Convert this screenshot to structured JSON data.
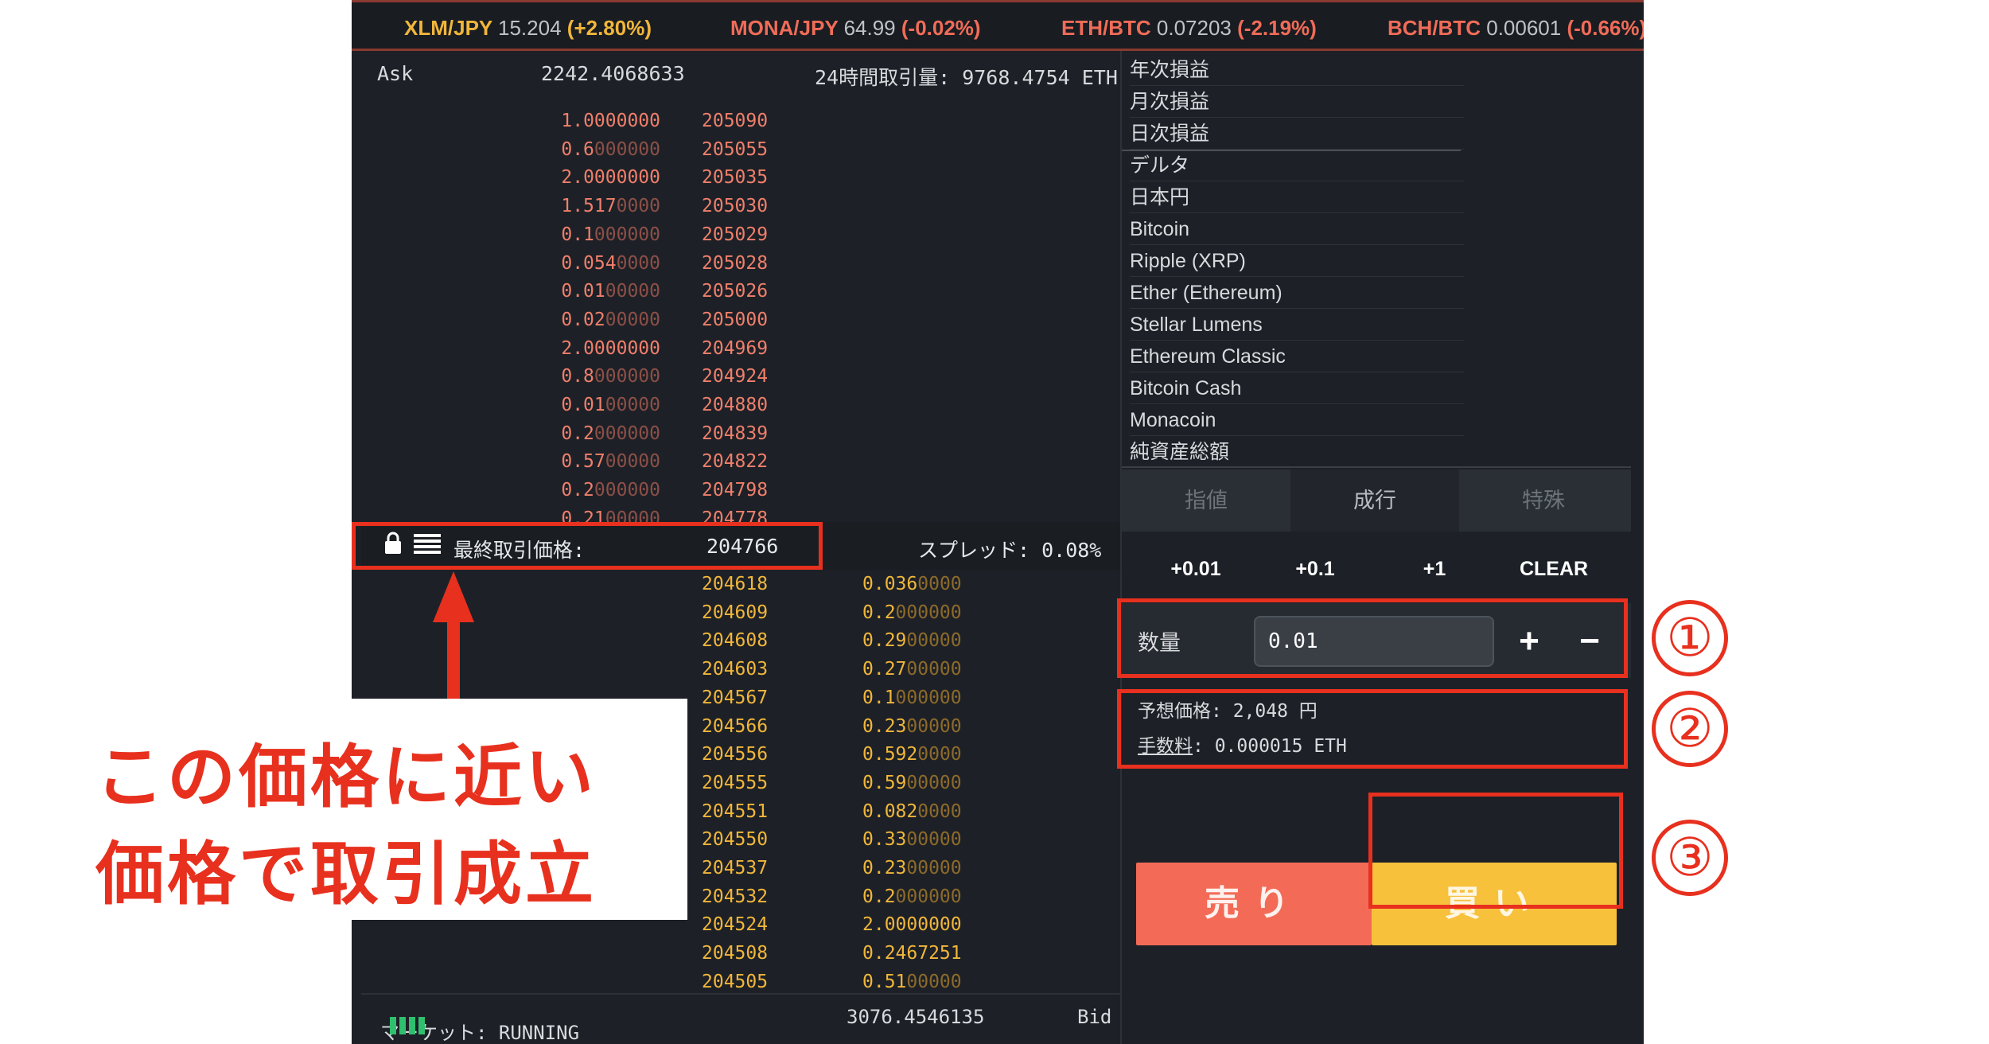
{
  "ticker": [
    {
      "symbol": "XLM/JPY",
      "price": "15.204",
      "change": "(+2.80%)",
      "dir": "up"
    },
    {
      "symbol": "MONA/JPY",
      "price": "64.99",
      "change": "(-0.02%)",
      "dir": "down"
    },
    {
      "symbol": "ETH/BTC",
      "price": "0.07203",
      "change": "(-2.19%)",
      "dir": "down"
    },
    {
      "symbol": "BCH/BTC",
      "price": "0.00601",
      "change": "(-0.66%)",
      "dir": "down"
    }
  ],
  "book": {
    "ask_label": "Ask",
    "ask_total": "2242.4068633",
    "volume_24h": "24時間取引量: 9768.4754 ETH",
    "asks": [
      {
        "qty": "1.0000000",
        "price": "205090"
      },
      {
        "qty": "0.6000000",
        "price": "205055"
      },
      {
        "qty": "2.0000000",
        "price": "205035"
      },
      {
        "qty": "1.5170000",
        "price": "205030"
      },
      {
        "qty": "0.1000000",
        "price": "205029"
      },
      {
        "qty": "0.0540000",
        "price": "205028"
      },
      {
        "qty": "0.0100000",
        "price": "205026"
      },
      {
        "qty": "0.0200000",
        "price": "205000"
      },
      {
        "qty": "2.0000000",
        "price": "204969"
      },
      {
        "qty": "0.8000000",
        "price": "204924"
      },
      {
        "qty": "0.0100000",
        "price": "204880"
      },
      {
        "qty": "0.2000000",
        "price": "204839"
      },
      {
        "qty": "0.5700000",
        "price": "204822"
      },
      {
        "qty": "0.2000000",
        "price": "204798"
      },
      {
        "qty": "0.2100000",
        "price": "204778"
      }
    ],
    "last_label": "最終取引価格:",
    "last_price": "204766",
    "spread": "スプレッド: 0.08%",
    "bids": [
      {
        "price": "204618",
        "qty": "0.0360000"
      },
      {
        "price": "204609",
        "qty": "0.2000000"
      },
      {
        "price": "204608",
        "qty": "0.2900000"
      },
      {
        "price": "204603",
        "qty": "0.2700000"
      },
      {
        "price": "204567",
        "qty": "0.1000000"
      },
      {
        "price": "204566",
        "qty": "0.2300000"
      },
      {
        "price": "204556",
        "qty": "0.5920000"
      },
      {
        "price": "204555",
        "qty": "0.5900000"
      },
      {
        "price": "204551",
        "qty": "0.0820000"
      },
      {
        "price": "204550",
        "qty": "0.3300000"
      },
      {
        "price": "204537",
        "qty": "0.2300000"
      },
      {
        "price": "204532",
        "qty": "0.2000000"
      },
      {
        "price": "204524",
        "qty": "2.0000000"
      },
      {
        "price": "204508",
        "qty": "0.2467251"
      },
      {
        "price": "204505",
        "qty": "0.5100000"
      }
    ],
    "market_status": "マーケット: RUNNING",
    "bid_total": "3076.4546135",
    "bid_label": "Bid"
  },
  "summary": [
    "年次損益",
    "月次損益",
    "日次損益",
    "デルタ",
    "日本円",
    "Bitcoin",
    "Ripple (XRP)",
    "Ether (Ethereum)",
    "Stellar Lumens",
    "Ethereum Classic",
    "Bitcoin Cash",
    "Monacoin",
    "純資産総額"
  ],
  "order": {
    "tabs": [
      "指値",
      "成行",
      "特殊"
    ],
    "active_tab": 1,
    "quick": [
      "+0.01",
      "+0.1",
      "+1",
      "CLEAR"
    ],
    "qty_label": "数量",
    "qty_value": "0.01",
    "plus": "+",
    "minus": "−",
    "est_label": "予想価格:",
    "est_value": "2,048 円",
    "fee_label": "手数料",
    "fee_value": ": 0.000015 ETH",
    "sell": "売り",
    "buy": "買い"
  },
  "annotations": {
    "callout": [
      "この価格に近い",
      "価格で取引成立"
    ],
    "steps": [
      "①",
      "②",
      "③"
    ],
    "color": "#e8301e"
  },
  "colors": {
    "bg": "#1d2127",
    "ask": "#f07f6b",
    "bid": "#f1b63a",
    "sell_button": "#f36b57",
    "buy_button": "#f8c13c"
  }
}
